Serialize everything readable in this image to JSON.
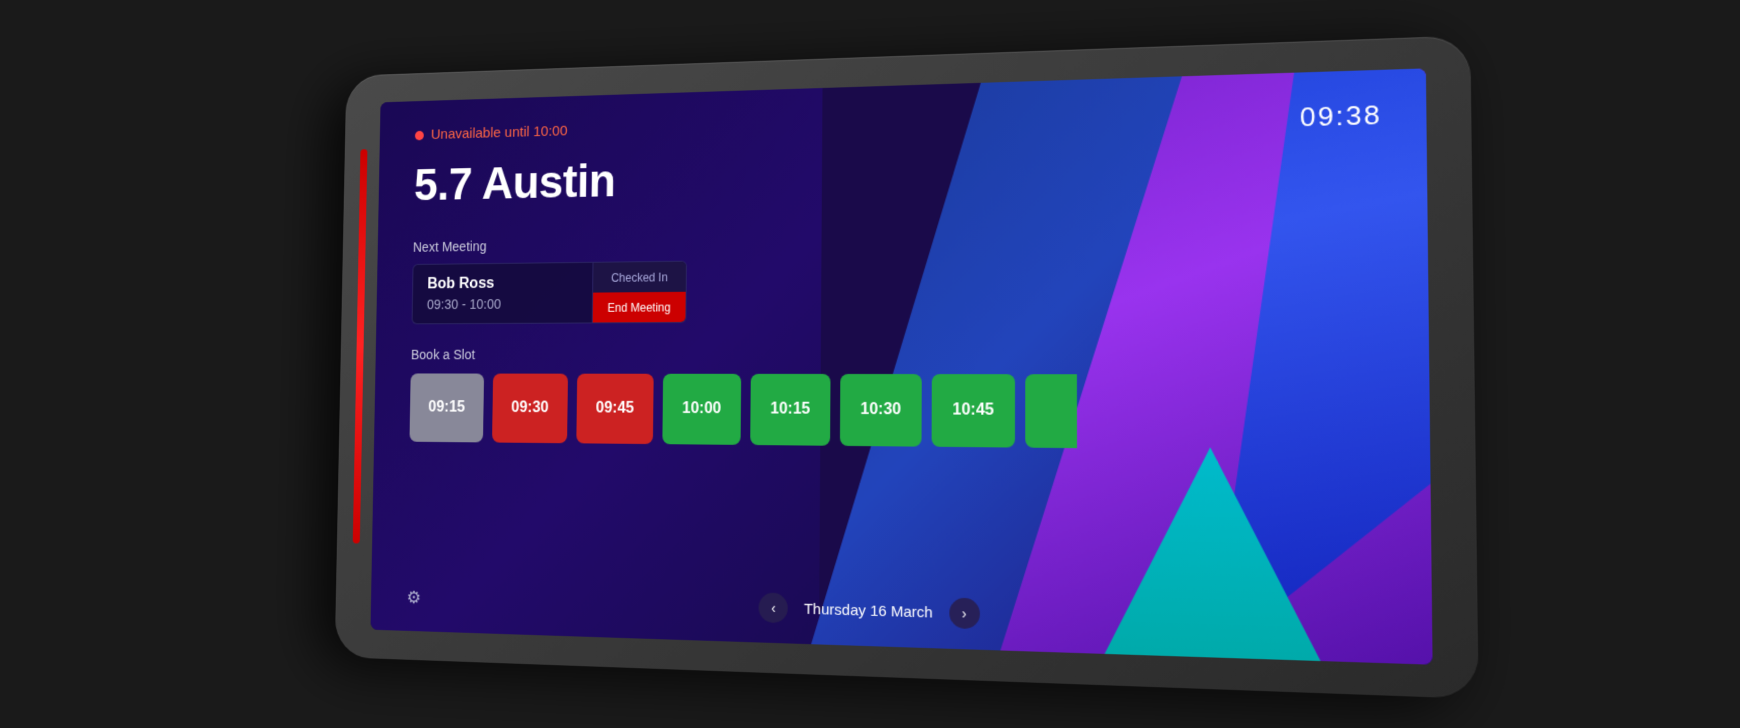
{
  "device": {
    "screen_bg": "#1a0855"
  },
  "header": {
    "status_text": "Unavailable until 10:00",
    "time": "09:38",
    "room_name": "5.7 Austin"
  },
  "next_meeting": {
    "label": "Next Meeting",
    "meeting_name": "Bob Ross",
    "meeting_time": "09:30 - 10:00",
    "checked_in_label": "Checked In",
    "end_meeting_label": "End Meeting"
  },
  "book_slot": {
    "label": "Book a Slot",
    "slots": [
      {
        "time": "09:15",
        "type": "gray"
      },
      {
        "time": "09:30",
        "type": "red"
      },
      {
        "time": "09:45",
        "type": "red"
      },
      {
        "time": "10:00",
        "type": "green"
      },
      {
        "time": "10:15",
        "type": "green"
      },
      {
        "time": "10:30",
        "type": "green"
      },
      {
        "time": "10:45",
        "type": "green"
      }
    ]
  },
  "bottom": {
    "date": "Thursday 16 March",
    "prev_arrow": "‹",
    "next_arrow": "›",
    "settings_icon": "⚙"
  }
}
